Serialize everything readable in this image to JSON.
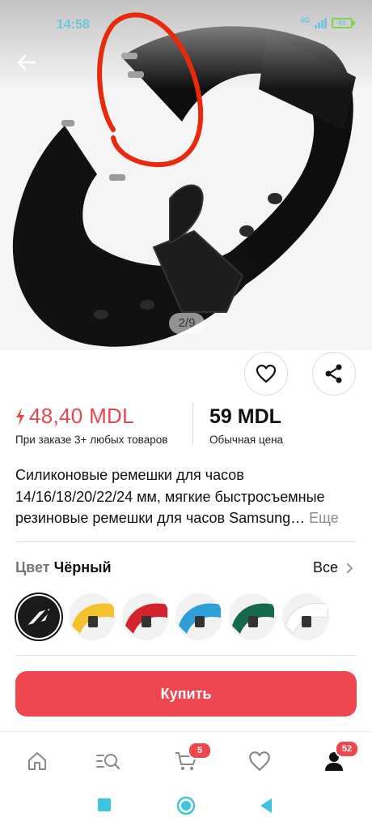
{
  "status_bar": {
    "time": "14:58",
    "network": "4G",
    "battery": "61"
  },
  "gallery": {
    "pager": "2/9"
  },
  "prices": {
    "sale_price": "48,40 MDL",
    "sale_note": "При заказе 3+ любых товаров",
    "regular_price": "59 MDL",
    "regular_note": "Обычная цена"
  },
  "description": {
    "text": "Силиконовые ремешки для часов 14/16/18/20/22/24 мм, мягкие быстросъемные резиновые ремешки для часов Samsung…",
    "more_label": "Еще"
  },
  "color": {
    "key": "Цвет",
    "value": "Чёрный",
    "all_label": "Все",
    "swatches": [
      {
        "name": "black",
        "hex": "#1b1b1b"
      },
      {
        "name": "yellow",
        "hex": "#f4c22c"
      },
      {
        "name": "red",
        "hex": "#d4232d"
      },
      {
        "name": "blue",
        "hex": "#2e9ed8"
      },
      {
        "name": "green",
        "hex": "#146a4a"
      },
      {
        "name": "white",
        "hex": "#f2f2f2"
      }
    ]
  },
  "buy_button": {
    "label": "Купить"
  },
  "bottom_nav": {
    "items": [
      {
        "icon": "home-icon"
      },
      {
        "icon": "catalog-search-icon"
      },
      {
        "icon": "cart-icon",
        "badge": "5"
      },
      {
        "icon": "heart-icon"
      },
      {
        "icon": "profile-icon",
        "badge": "52"
      }
    ]
  },
  "colors": {
    "accent": "#ef474f",
    "sale": "#e8454d",
    "status": "#6cc7da"
  }
}
